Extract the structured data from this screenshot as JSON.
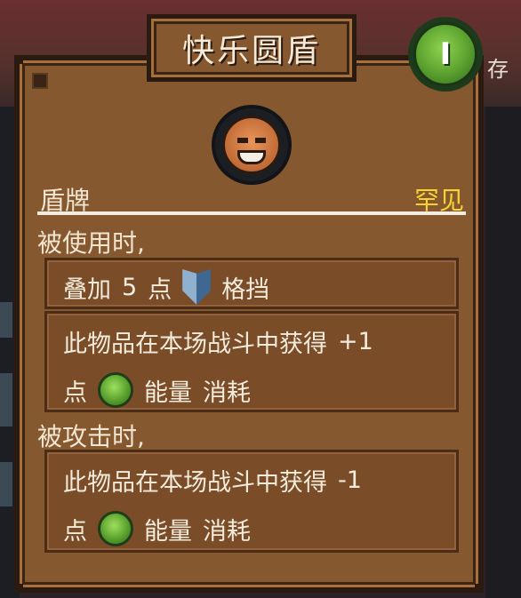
{
  "title": "快乐圆盾",
  "badge": "I",
  "side_label": "存",
  "item_type": "盾牌",
  "rarity": "罕见",
  "colors": {
    "rarity": "#f6d234",
    "panel": "#86582f",
    "text": "#f3ebdc"
  },
  "sections": [
    {
      "header": "被使用时,",
      "effects": [
        {
          "lines": [
            [
              "叠加",
              "5",
              "点",
              "格挡"
            ]
          ],
          "icon": "shield-icon"
        },
        {
          "lines": [
            [
              "此物品在本场战斗中获得",
              "+1"
            ],
            [
              "点",
              "能量",
              "消耗"
            ]
          ],
          "icon": "energy-icon"
        }
      ]
    },
    {
      "header": "被攻击时,",
      "effects": [
        {
          "lines": [
            [
              "此物品在本场战斗中获得",
              "-1"
            ],
            [
              "点",
              "能量",
              "消耗"
            ]
          ],
          "icon": "energy-icon"
        }
      ]
    }
  ]
}
